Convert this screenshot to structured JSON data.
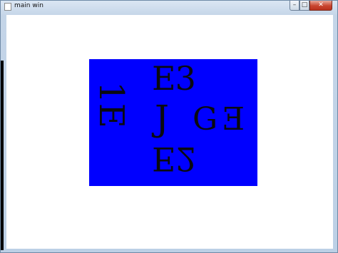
{
  "window": {
    "title": "main win",
    "controls": {
      "minimize": "–",
      "maximize": "□",
      "close": "✕"
    }
  },
  "canvas": {
    "background": "#0000ff",
    "glyphs": {
      "e3": "E3",
      "j": "J",
      "g": "G",
      "e_mirror": "E",
      "one_e": "1E",
      "e2": "E2"
    }
  }
}
